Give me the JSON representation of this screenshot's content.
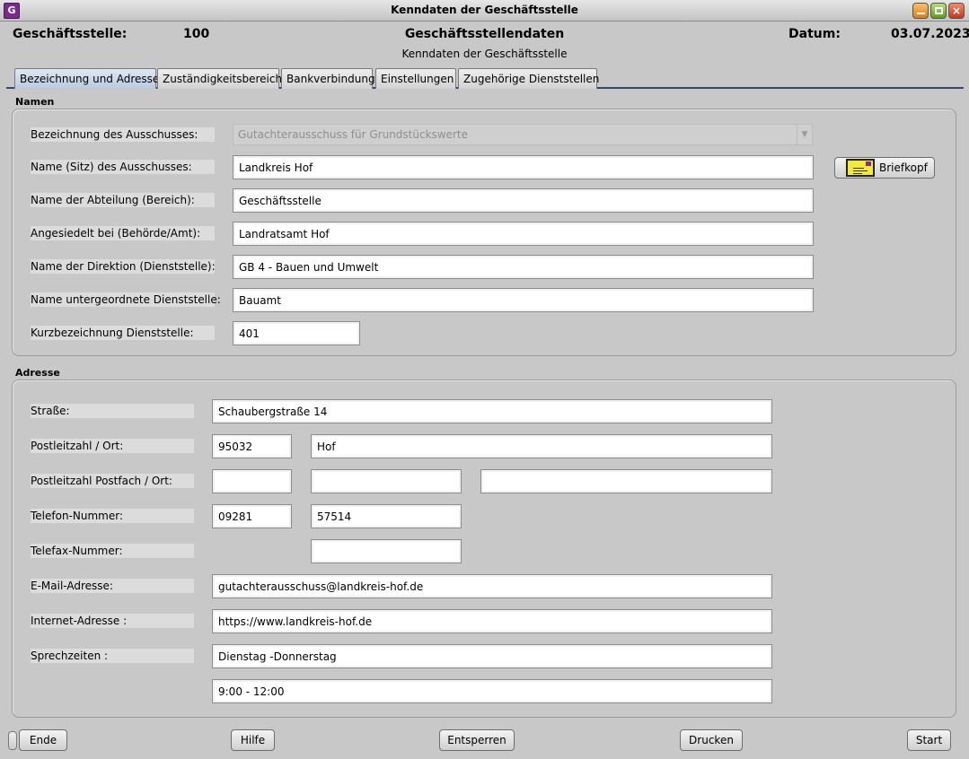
{
  "window": {
    "title": "Kenndaten der Geschäftsstelle",
    "app_icon_letter": "G"
  },
  "header": {
    "office_label": "Geschäftsstelle:",
    "office_number": "100",
    "section_title": "Geschäftsstellendaten",
    "section_subtitle": "Kenndaten der Geschäftsstelle",
    "date_label": "Datum:",
    "date_value": "03.07.2023"
  },
  "tabs": [
    {
      "label": "Bezeichnung und Adresse",
      "active": true
    },
    {
      "label": "Zuständigkeitsbereich"
    },
    {
      "label": "Bankverbindung"
    },
    {
      "label": "Einstellungen"
    },
    {
      "label": "Zugehörige Dienststellen"
    }
  ],
  "names": {
    "title": "Namen",
    "committee_label": "Bezeichnung des Ausschusses:",
    "committee_value": "Gutachterausschuss für Grundstückswerte",
    "seat_label": "Name (Sitz) des Ausschusses:",
    "seat_value": "Landkreis Hof",
    "department_label": "Name der Abteilung (Bereich):",
    "department_value": "Geschäftsstelle",
    "authority_label": "Angesiedelt bei (Behörde/Amt):",
    "authority_value": "Landratsamt Hof",
    "directorate_label": "Name der Direktion (Dienststelle):",
    "directorate_value": "GB 4 - Bauen und Umwelt",
    "sub_office_label": "Name untergeordnete Dienststelle:",
    "sub_office_value": "Bauamt",
    "short_label": "Kurzbezeichnung Dienststelle:",
    "short_value": "401",
    "letterhead_button": "Briefkopf"
  },
  "address": {
    "title": "Adresse",
    "street_label": "Straße:",
    "street_value": "Schaubergstraße 14",
    "postal_label": "Postleitzahl / Ort:",
    "postal_value": "95032",
    "city_value": "Hof",
    "pobox_label": "Postleitzahl Postfach / Ort:",
    "pobox_postal_value": "",
    "pobox_number_value": "",
    "pobox_city_value": "",
    "phone_label": "Telefon-Nummer:",
    "phone_area_value": "09281",
    "phone_number_value": "57514",
    "fax_label": "Telefax-Nummer:",
    "fax_value": "",
    "email_label": "E-Mail-Adresse:",
    "email_value": "gutachterausschuss@landkreis-hof.de",
    "web_label": "Internet-Adresse :",
    "web_value": "https://www.landkreis-hof.de",
    "hours_label": "Sprechzeiten :",
    "hours_days_value": "Dienstag -Donnerstag",
    "hours_time_value": "9:00 - 12:00"
  },
  "footer": {
    "end": "Ende",
    "help": "Hilfe",
    "unlock": "Entsperren",
    "print": "Drucken",
    "start": "Start"
  },
  "colors": {
    "background": "#c8c8c8",
    "tab_underline": "#334a6e",
    "app_icon": "#7a2b8c",
    "letterhead_icon": "#f5ea3c"
  }
}
